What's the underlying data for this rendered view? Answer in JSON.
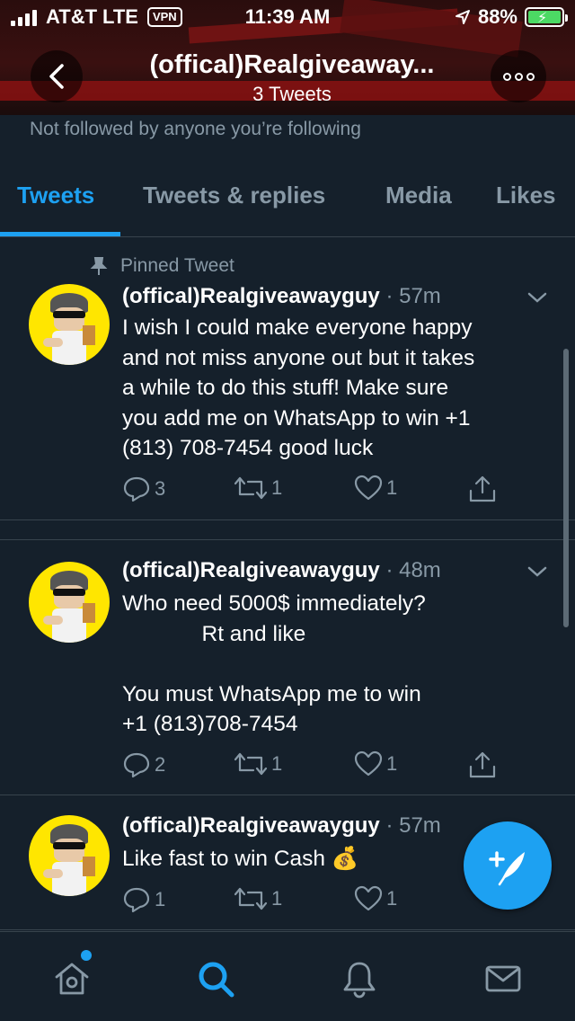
{
  "status_bar": {
    "carrier": "AT&T",
    "network": "LTE",
    "vpn": "VPN",
    "time": "11:39 AM",
    "battery": "88%"
  },
  "profile_header": {
    "title": "(offical)Realgiveaway...",
    "tweet_count": "3 Tweets",
    "not_followed": "Not followed by anyone you’re following"
  },
  "tabs": [
    {
      "label": "Tweets",
      "active": true
    },
    {
      "label": "Tweets & replies",
      "active": false
    },
    {
      "label": "Media",
      "active": false
    },
    {
      "label": "Likes",
      "active": false
    }
  ],
  "tweets": [
    {
      "pinned_label": "Pinned Tweet",
      "name": "(offical)Realgiveawayguy",
      "time": "· 57m",
      "text": "I wish I could make everyone happy\nand not miss anyone out but it takes\na while to do this stuff! Make sure\nyou add me on WhatsApp to win +1\n(813) 708-7454 good luck",
      "replies": "3",
      "retweets": "1",
      "likes": "1"
    },
    {
      "name": "(offical)Realgiveawayguy",
      "time": "· 48m",
      "text": "Who need 5000$ immediately?\n             Rt and like\n\nYou must WhatsApp me to win\n+1 (813)708-7454",
      "replies": "2",
      "retweets": "1",
      "likes": "1"
    },
    {
      "name": "(offical)Realgiveawayguy",
      "time": "· 57m",
      "text": "Like fast to win Cash 💰",
      "replies": "1",
      "retweets": "1",
      "likes": "1"
    }
  ],
  "colors": {
    "background": "#15202b",
    "accent": "#1da1f2",
    "muted": "#8899a6",
    "divider": "#38444d"
  },
  "icons": {
    "back": "chevron-left-icon",
    "more": "more-icon",
    "reply": "reply-icon",
    "retweet": "retweet-icon",
    "like": "heart-icon",
    "share": "share-icon",
    "compose": "compose-icon",
    "home": "home-icon",
    "search": "search-icon",
    "notifications": "bell-icon",
    "messages": "mail-icon"
  }
}
